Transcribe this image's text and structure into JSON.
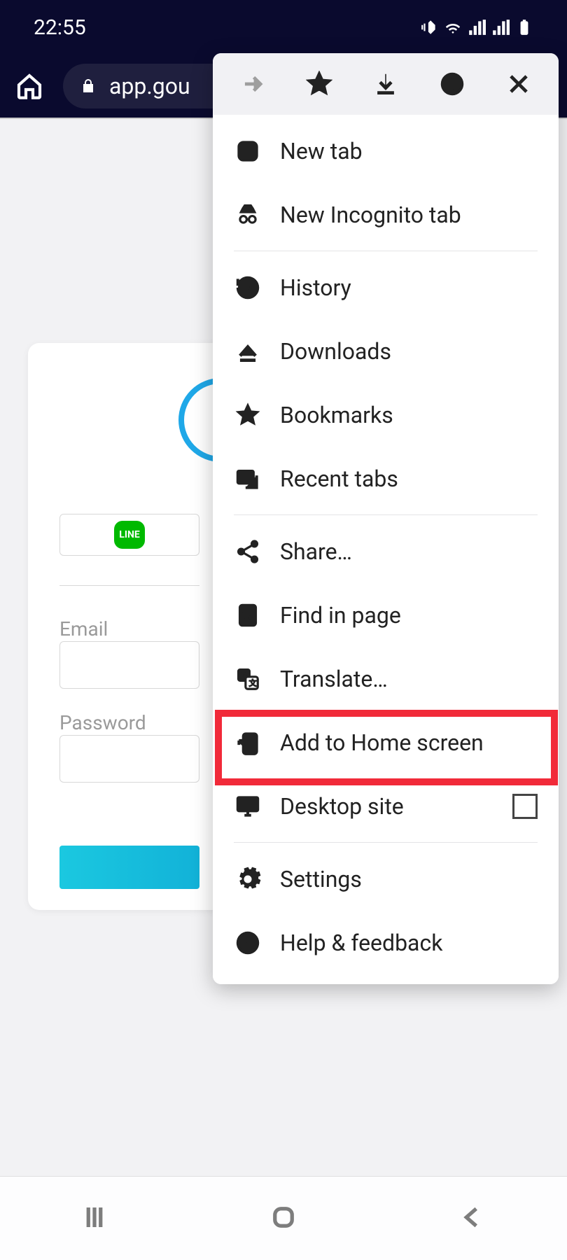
{
  "status": {
    "time": "22:55"
  },
  "urlbar": {
    "url": "app.gou"
  },
  "page": {
    "line_label": "LINE",
    "email_label": "Email",
    "password_label": "Password"
  },
  "menu": {
    "items": [
      {
        "label": "New tab"
      },
      {
        "label": "New Incognito tab"
      },
      {
        "label": "History"
      },
      {
        "label": "Downloads"
      },
      {
        "label": "Bookmarks"
      },
      {
        "label": "Recent tabs"
      },
      {
        "label": "Share…"
      },
      {
        "label": "Find in page"
      },
      {
        "label": "Translate…"
      },
      {
        "label": "Add to Home screen"
      },
      {
        "label": "Desktop site"
      },
      {
        "label": "Settings"
      },
      {
        "label": "Help & feedback"
      }
    ]
  }
}
